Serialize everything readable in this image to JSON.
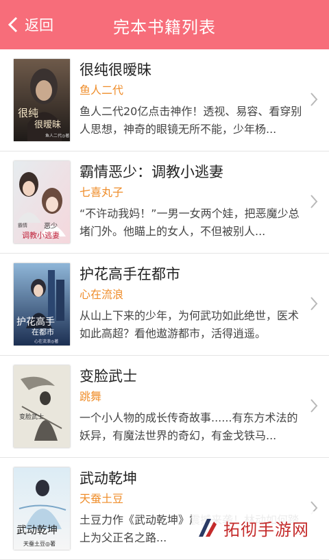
{
  "header": {
    "back_label": "返回",
    "title": "完本书籍列表",
    "background": "#f76d7a"
  },
  "books": [
    {
      "title": "很纯很暧昧",
      "author": "鱼人二代",
      "description": "鱼人二代20亿点击神作！透视、易容、看穿别人思想，神奇的眼镜无所不能，少年杨...",
      "cover": {
        "name": "cover-henchun",
        "lines": [
          "很纯",
          "很暧昧"
        ],
        "small": "鱼人二代◎著"
      }
    },
    {
      "title": "霸情恶少：调教小逃妻",
      "author": "七喜丸子",
      "description": "“不许动我妈！”一男一女两个娃，把恶魔少总堵门外。他瞄上的女人，不但被别人...",
      "cover": {
        "name": "cover-baqing",
        "lines": [
          "恶少",
          "调教小逃妻"
        ],
        "small": "霸情"
      }
    },
    {
      "title": "护花高手在都市",
      "author": "心在流浪",
      "description": "从山上下来的少年，为何武功如此绝世，医术如此高超？看他遨游都市，活得逍遥。",
      "cover": {
        "name": "cover-huhua",
        "lines": [
          "护花高手",
          "在都市"
        ],
        "small": "心在流浪◎著"
      }
    },
    {
      "title": "变脸武士",
      "author": "跳舞",
      "description": "一个小人物的成长传奇故事......有东方术法的妖异，有魔法世界的奇幻，有金戈铁马...",
      "cover": {
        "name": "cover-bianlian",
        "lines": [
          "变脸武士"
        ],
        "small": ""
      }
    },
    {
      "title": "武动乾坤",
      "author": "天蚕土豆",
      "description": "土豆力作《武动乾坤》震撼来袭！林动如何踏上为父正名之路...",
      "cover": {
        "name": "cover-wudong",
        "lines": [
          "武动乾坤"
        ],
        "small": "天蚕土豆◎著"
      }
    }
  ],
  "watermark": {
    "text": "拓彻手游网"
  },
  "colors": {
    "author": "#ef8d2a",
    "title": "#222222",
    "desc": "#444444"
  }
}
